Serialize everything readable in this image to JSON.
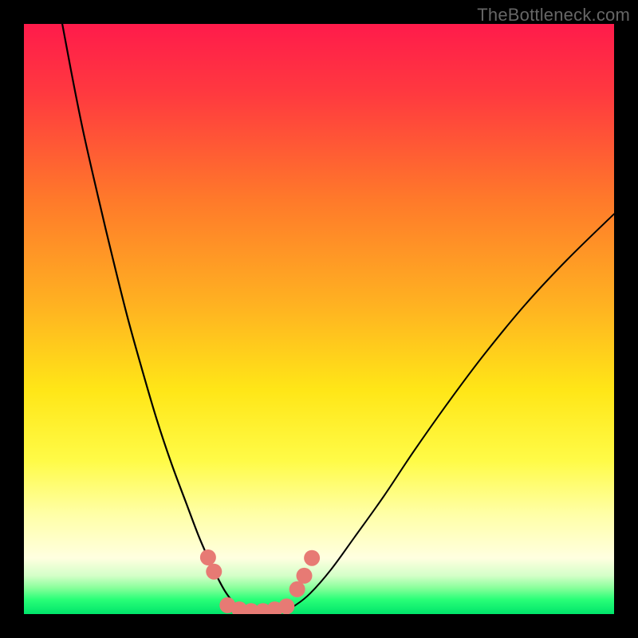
{
  "watermark": "TheBottleneck.com",
  "chart_data": {
    "type": "line",
    "title": "",
    "xlabel": "",
    "ylabel": "",
    "xlim": [
      0,
      100
    ],
    "ylim": [
      0,
      100
    ],
    "grid": false,
    "legend": false,
    "background_gradient_stops": [
      {
        "pos": 0.0,
        "color": "#ff1b4b"
      },
      {
        "pos": 0.12,
        "color": "#ff3a3f"
      },
      {
        "pos": 0.3,
        "color": "#ff7a2a"
      },
      {
        "pos": 0.48,
        "color": "#ffb321"
      },
      {
        "pos": 0.62,
        "color": "#ffe617"
      },
      {
        "pos": 0.74,
        "color": "#fffb47"
      },
      {
        "pos": 0.83,
        "color": "#ffffa6"
      },
      {
        "pos": 0.905,
        "color": "#ffffe0"
      },
      {
        "pos": 0.935,
        "color": "#d4ffc8"
      },
      {
        "pos": 0.955,
        "color": "#8bff9c"
      },
      {
        "pos": 0.975,
        "color": "#2aff78"
      },
      {
        "pos": 1.0,
        "color": "#00e56a"
      }
    ],
    "series": [
      {
        "name": "bottleneck-curve-left",
        "stroke": "#000000",
        "stroke_width": 2.2,
        "points": [
          {
            "x": 6.5,
            "y": 100.0
          },
          {
            "x": 8.0,
            "y": 92.0
          },
          {
            "x": 10.0,
            "y": 82.0
          },
          {
            "x": 12.5,
            "y": 71.0
          },
          {
            "x": 15.0,
            "y": 60.5
          },
          {
            "x": 17.5,
            "y": 50.5
          },
          {
            "x": 20.0,
            "y": 41.5
          },
          {
            "x": 22.5,
            "y": 33.0
          },
          {
            "x": 25.0,
            "y": 25.5
          },
          {
            "x": 27.5,
            "y": 18.8
          },
          {
            "x": 29.5,
            "y": 13.5
          },
          {
            "x": 31.0,
            "y": 10.0
          },
          {
            "x": 32.5,
            "y": 6.8
          },
          {
            "x": 34.0,
            "y": 4.0
          },
          {
            "x": 35.5,
            "y": 2.0
          },
          {
            "x": 37.0,
            "y": 0.8
          },
          {
            "x": 38.5,
            "y": 0.2
          },
          {
            "x": 40.0,
            "y": 0.0
          }
        ]
      },
      {
        "name": "bottleneck-curve-right",
        "stroke": "#000000",
        "stroke_width": 2.0,
        "points": [
          {
            "x": 40.0,
            "y": 0.0
          },
          {
            "x": 42.0,
            "y": 0.1
          },
          {
            "x": 44.0,
            "y": 0.5
          },
          {
            "x": 46.0,
            "y": 1.5
          },
          {
            "x": 48.5,
            "y": 3.5
          },
          {
            "x": 52.0,
            "y": 7.5
          },
          {
            "x": 56.0,
            "y": 13.0
          },
          {
            "x": 61.0,
            "y": 20.0
          },
          {
            "x": 66.0,
            "y": 27.5
          },
          {
            "x": 72.0,
            "y": 36.0
          },
          {
            "x": 78.0,
            "y": 44.0
          },
          {
            "x": 85.0,
            "y": 52.5
          },
          {
            "x": 92.0,
            "y": 60.0
          },
          {
            "x": 100.0,
            "y": 67.8
          }
        ]
      }
    ],
    "scatter": {
      "name": "sample-points",
      "color": "#e77a74",
      "radius_px": 10,
      "points": [
        {
          "x": 31.2,
          "y": 9.6
        },
        {
          "x": 32.2,
          "y": 7.2
        },
        {
          "x": 34.5,
          "y": 1.5
        },
        {
          "x": 36.5,
          "y": 0.8
        },
        {
          "x": 38.5,
          "y": 0.5
        },
        {
          "x": 40.5,
          "y": 0.5
        },
        {
          "x": 42.5,
          "y": 0.8
        },
        {
          "x": 44.5,
          "y": 1.3
        },
        {
          "x": 46.3,
          "y": 4.2
        },
        {
          "x": 47.5,
          "y": 6.5
        },
        {
          "x": 48.8,
          "y": 9.5
        }
      ]
    }
  }
}
